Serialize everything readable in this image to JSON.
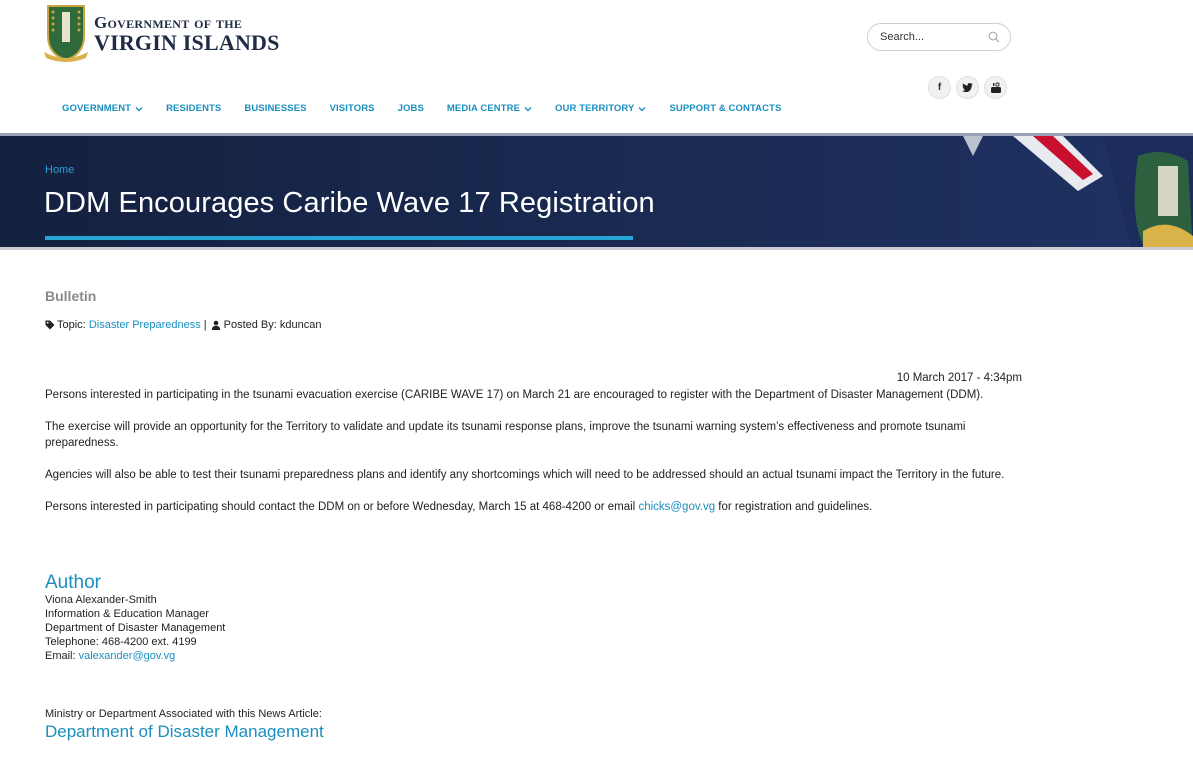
{
  "header": {
    "logo_line1": "Government of the",
    "logo_line2": "VIRGIN ISLANDS",
    "search": {
      "placeholder": "Search..."
    },
    "social": [
      {
        "label": "f",
        "icon": "facebook-icon"
      },
      {
        "label": "",
        "icon": "twitter-icon"
      },
      {
        "label": "",
        "icon": "youtube-icon"
      }
    ],
    "nav": [
      {
        "label": "GOVERNMENT",
        "dropdown": true
      },
      {
        "label": "RESIDENTS",
        "dropdown": false
      },
      {
        "label": "BUSINESSES",
        "dropdown": false
      },
      {
        "label": "VISITORS",
        "dropdown": false
      },
      {
        "label": "JOBS",
        "dropdown": false
      },
      {
        "label": "MEDIA CENTRE",
        "dropdown": true
      },
      {
        "label": "OUR TERRITORY",
        "dropdown": true
      },
      {
        "label": "SUPPORT & CONTACTS",
        "dropdown": false
      }
    ]
  },
  "banner": {
    "breadcrumb": "Home",
    "title": "DDM Encourages Caribe Wave 17 Registration"
  },
  "article": {
    "section": "Bulletin",
    "topic_label": "Topic:",
    "topic": "Disaster Preparedness",
    "separator": "|",
    "posted_label": "Posted By:",
    "posted_by": "kduncan",
    "date": "10 March 2017 - 4:34pm",
    "paragraphs": [
      "Persons interested in participating in the tsunami evacuation exercise (CARIBE WAVE 17) on March 21 are encouraged to register with the Department of Disaster Management (DDM).",
      "The exercise will provide an opportunity for the Territory to validate and update its tsunami response plans, improve the tsunami warning system’s effectiveness and promote tsunami preparedness.",
      "Agencies will also be able to test their tsunami preparedness plans and identify any shortcomings which will need to be addressed should an actual tsunami impact the Territory in the future."
    ],
    "last_paragraph": {
      "before": "Persons interested in participating should contact the DDM on or before Wednesday, March 15 at 468-4200 or email ",
      "email": "chicks@gov.vg",
      "after": " for registration and guidelines."
    }
  },
  "author": {
    "heading": "Author",
    "name": "Viona Alexander-Smith",
    "role": "Information & Education Manager",
    "department": "Department of Disaster Management",
    "telephone": "Telephone: 468-4200 ext. 4199",
    "email_label": "Email:",
    "email": "valexander@gov.vg"
  },
  "ministry": {
    "label": "Ministry or Department Associated with this News Article:",
    "link": "Department of Disaster Management"
  },
  "colors": {
    "link": "#1a8fbf",
    "banner": "#1a2a52",
    "accent": "#27a3d6"
  }
}
